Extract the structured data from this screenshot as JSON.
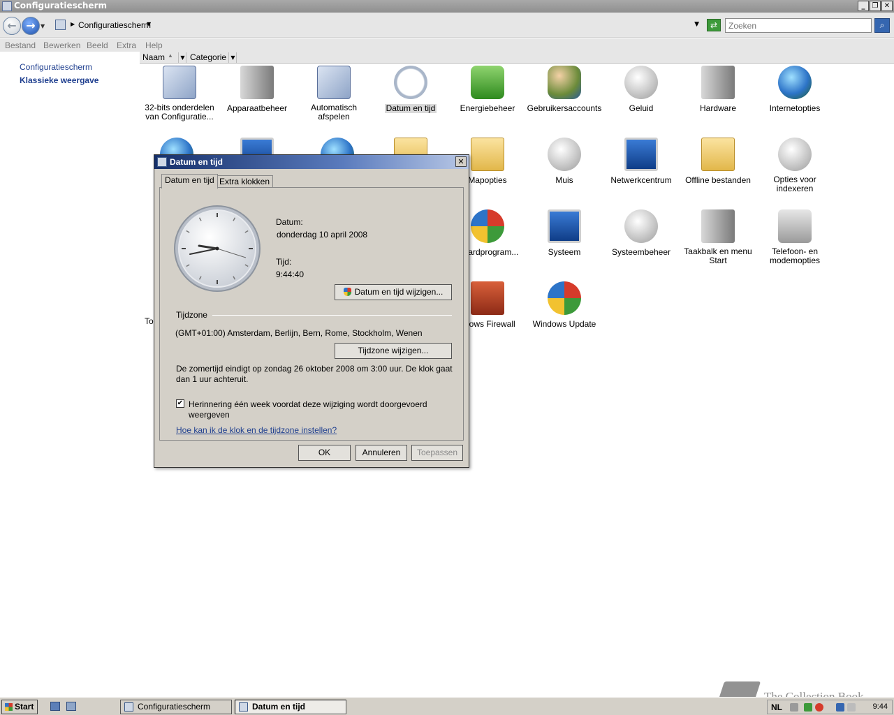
{
  "window": {
    "title": "Configuratiescherm",
    "buttons": {
      "minimize": "_",
      "restore": "❐",
      "close": "✕"
    }
  },
  "addressbar": {
    "back_glyph": "←",
    "forward_glyph": "→",
    "location": "Configuratiescherm",
    "search_placeholder": "Zoeken",
    "refresh_glyph": "⇄",
    "search_glyph": "⌕"
  },
  "menu": [
    "Bestand",
    "Bewerken",
    "Beeld",
    "Extra",
    "Help"
  ],
  "leftpane": {
    "home_link": "Configuratiescherm",
    "classic_view": "Klassieke weergave"
  },
  "columns": {
    "name": "Naam",
    "category": "Categorie"
  },
  "icons": {
    "row1": [
      {
        "label": "32-bits onderdelen van Configuratie...",
        "icon": "32bit-components-icon"
      },
      {
        "label": "Apparaatbeheer",
        "icon": "device-manager-icon"
      },
      {
        "label": "Automatisch afspelen",
        "icon": "autoplay-icon"
      },
      {
        "label": "Datum en tijd",
        "icon": "date-time-icon"
      },
      {
        "label": "Energiebeheer",
        "icon": "power-icon"
      },
      {
        "label": "Gebruikersaccounts",
        "icon": "user-accounts-icon"
      },
      {
        "label": "Geluid",
        "icon": "sound-icon"
      },
      {
        "label": "Hardware",
        "icon": "hardware-icon"
      },
      {
        "label": "Internetopties",
        "icon": "internet-options-icon"
      }
    ],
    "row2": [
      {
        "label": "Mapopties",
        "icon": "folder-options-icon"
      },
      {
        "label": "Muis",
        "icon": "mouse-icon"
      },
      {
        "label": "Netwerkcentrum",
        "icon": "network-center-icon"
      },
      {
        "label": "Offline bestanden",
        "icon": "offline-files-icon"
      },
      {
        "label": "Opties voor indexeren",
        "icon": "indexing-icon"
      }
    ],
    "row3": [
      {
        "label": "...aardprogram...",
        "icon": "default-programs-icon"
      },
      {
        "label": "Systeem",
        "icon": "system-icon"
      },
      {
        "label": "Systeembeheer",
        "icon": "admin-tools-icon"
      },
      {
        "label": "Taakbalk en menu Start",
        "icon": "taskbar-icon"
      },
      {
        "label": "Telefoon- en modemopties",
        "icon": "phone-modem-icon"
      }
    ],
    "row4": [
      {
        "label": "ndows Firewall",
        "icon": "firewall-icon"
      },
      {
        "label": "Windows Update",
        "icon": "windows-update-icon"
      }
    ],
    "partial_label": "To"
  },
  "dialog": {
    "title": "Datum en tijd",
    "close_glyph": "✕",
    "tabs": [
      "Datum en tijd",
      "Extra klokken"
    ],
    "date_label": "Datum:",
    "date_value": "donderdag 10 april 2008",
    "time_label": "Tijd:",
    "time_value": "9:44:40",
    "change_datetime_button": "Datum en tijd wijzigen...",
    "timezone_heading": "Tijdzone",
    "timezone_value": "(GMT+01:00) Amsterdam, Berlijn, Bern, Rome, Stockholm, Wenen",
    "change_timezone_button": "Tijdzone wijzigen...",
    "dst_info": "De zomertijd eindigt op zondag 26 oktober 2008 om 3:00 uur. De klok gaat dan 1 uur achteruit.",
    "reminder_checkbox": "Herinnering één week voordat deze wijziging wordt doorgevoerd weergeven",
    "reminder_checked": true,
    "check_glyph": "✔",
    "help_link": "Hoe kan ik de klok en de tijdzone instellen?",
    "ok_button": "OK",
    "cancel_button": "Annuleren",
    "apply_button": "Toepassen"
  },
  "taskbar": {
    "start": "Start",
    "tasks": [
      "Configuratiescherm",
      "Datum en tijd"
    ],
    "language": "NL",
    "clock": "9:44"
  },
  "watermark": "The Collection Book"
}
